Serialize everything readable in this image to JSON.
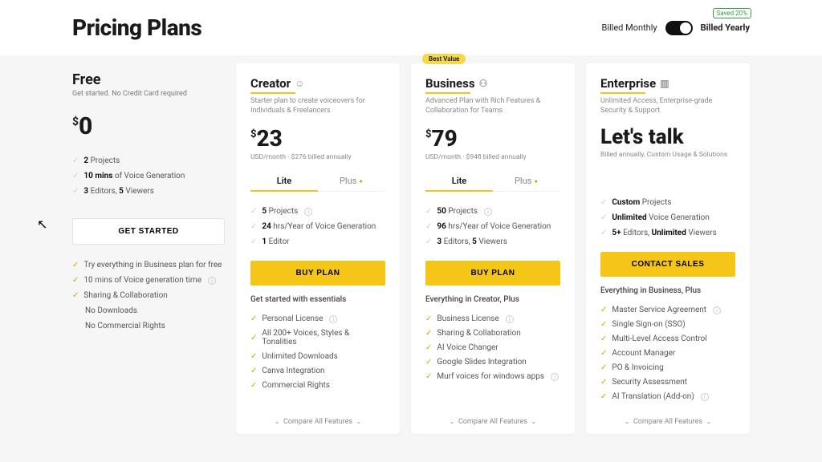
{
  "header": {
    "title": "Pricing Plans",
    "billed_monthly": "Billed Monthly",
    "billed_yearly": "Billed Yearly",
    "save_badge": "Saved 20%"
  },
  "free": {
    "title": "Free",
    "subtitle": "Get started. No Credit Card required",
    "price": "0",
    "feat1_bold": "2",
    "feat1_rest": "Projects",
    "feat2_bold": "10 mins",
    "feat2_rest": "of Voice Generation",
    "feat3_a": "3",
    "feat3_b": "Editors,",
    "feat3_c": "5",
    "feat3_d": "Viewers",
    "cta": "GET STARTED",
    "b1": "Try everything in Business plan for free",
    "b2": "10 mins of Voice generation time",
    "b3": "Sharing & Collaboration",
    "b4": "No Downloads",
    "b5": "No Commercial Rights"
  },
  "creator": {
    "title": "Creator",
    "desc": "Starter plan to create voiceovers for Individuals & Freelancers",
    "price": "23",
    "price_sub": "USD/month  ·  $276 billed annually",
    "tab_lite": "Lite",
    "tab_plus": "Plus",
    "f1_b": "5",
    "f1_r": "Projects",
    "f2_b": "24",
    "f2_r": "hrs/Year of Voice Generation",
    "f3_b": "1",
    "f3_r": "Editor",
    "cta": "BUY PLAN",
    "section": "Get started with essentials",
    "b1": "Personal License",
    "b2": "All 200+ Voices, Styles & Tonalities",
    "b3": "Unlimited Downloads",
    "b4": "Canva Integration",
    "b5": "Commercial Rights",
    "compare": "Compare All Features"
  },
  "business": {
    "badge": "Best Value",
    "title": "Business",
    "desc": "Advanced Plan with Rich Features & Collaboration for Teams",
    "price": "79",
    "price_sub": "USD/month  ·  $948 billed annually",
    "tab_lite": "Lite",
    "tab_plus": "Plus",
    "f1_b": "50",
    "f1_r": "Projects",
    "f2_b": "96",
    "f2_r": "hrs/Year of Voice Generation",
    "f3_a": "3",
    "f3_b": "Editors,",
    "f3_c": "5",
    "f3_d": "Viewers",
    "cta": "BUY PLAN",
    "section": "Everything in Creator, Plus",
    "b1": "Business License",
    "b2": "Sharing & Collaboration",
    "b3": "AI Voice Changer",
    "b4": "Google Slides Integration",
    "b5": "Murf voices for windows apps",
    "compare": "Compare All Features"
  },
  "enterprise": {
    "title": "Enterprise",
    "desc": "Unlimited Access, Enterprise-grade Security & Support",
    "price": "Let's talk",
    "price_sub": "Billed annually, Custom Usage & Solutions",
    "f1_b": "Custom",
    "f1_r": "Projects",
    "f2_b": "Unlimited",
    "f2_r": "Voice Generation",
    "f3_a": "5+",
    "f3_b": "Editors,",
    "f3_c": "Unlimited",
    "f3_d": "Viewers",
    "cta": "CONTACT SALES",
    "section": "Everything in Business, Plus",
    "b1": "Master Service Agreement",
    "b2": "Single Sign-on (SSO)",
    "b3": "Multi-Level Access Control",
    "b4": "Account Manager",
    "b5": "PO & Invoicing",
    "b6": "Security Assessment",
    "b7": "AI Translation (Add-on)",
    "compare": "Compare All Features"
  }
}
